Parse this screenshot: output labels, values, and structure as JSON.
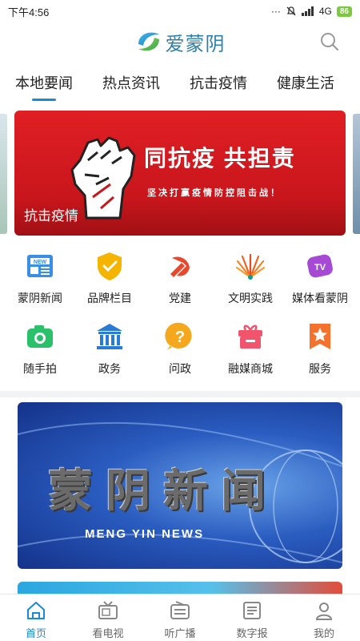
{
  "status": {
    "time": "下午4:56",
    "network": "4G",
    "battery": "86"
  },
  "app": {
    "name": "爱蒙阴"
  },
  "tabs": [
    "本地要闻",
    "热点资讯",
    "抗击疫情",
    "健康生活"
  ],
  "banner": {
    "title": "同抗疫 共担责",
    "subtitle": "坚决打赢疫情防控阻击战！",
    "caption": "抗击疫情"
  },
  "grid": [
    {
      "label": "蒙阴新闻",
      "icon": "newspaper-icon",
      "badge": "NEW"
    },
    {
      "label": "品牌栏目",
      "icon": "shield-check-icon"
    },
    {
      "label": "党建",
      "icon": "party-emblem-icon"
    },
    {
      "label": "文明实践",
      "icon": "fan-icon"
    },
    {
      "label": "媒体看蒙阴",
      "icon": "tv-icon",
      "badge": "TV"
    },
    {
      "label": "随手拍",
      "icon": "camera-icon"
    },
    {
      "label": "政务",
      "icon": "government-building-icon"
    },
    {
      "label": "问政",
      "icon": "question-icon"
    },
    {
      "label": "融媒商城",
      "icon": "gift-box-icon"
    },
    {
      "label": "服务",
      "icon": "star-bookmark-icon"
    }
  ],
  "news_card": {
    "title": "蒙阴新闻",
    "subtitle": "MENG YIN NEWS"
  },
  "bottom_nav": [
    {
      "label": "首页",
      "icon": "home-icon",
      "active": true
    },
    {
      "label": "看电视",
      "icon": "tv-icon"
    },
    {
      "label": "听广播",
      "icon": "radio-icon"
    },
    {
      "label": "数字报",
      "icon": "digital-paper-icon"
    },
    {
      "label": "我的",
      "icon": "user-icon"
    }
  ],
  "colors": {
    "accent": "#1a8ad6",
    "banner_red": "#d8191f"
  }
}
